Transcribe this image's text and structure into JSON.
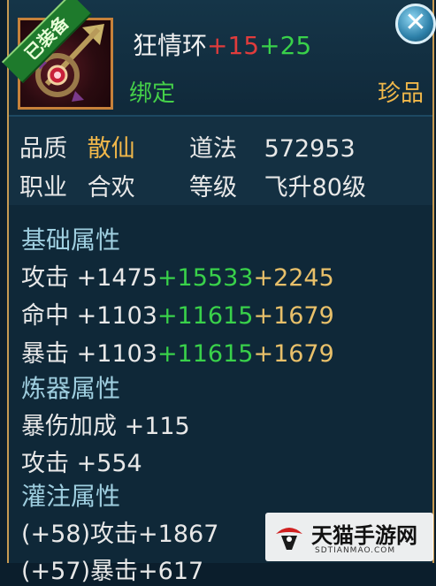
{
  "header": {
    "badge": "已装备",
    "item_name": "狂情环",
    "plus_red": "+15",
    "plus_green": "+25",
    "bind": "绑定",
    "rarity": "珍品",
    "close_icon": "close-icon"
  },
  "info": {
    "quality_label": "品质",
    "quality_value": "散仙",
    "dao_label": "道法",
    "dao_value": "572953",
    "job_label": "职业",
    "job_value": "合欢",
    "level_label": "等级",
    "level_value": "飞升80级"
  },
  "attributes": {
    "base_title": "基础属性",
    "base": [
      {
        "name": "攻击",
        "base": "+1475",
        "green": "+15533",
        "orange": "+2245"
      },
      {
        "name": "命中",
        "base": "+1103",
        "green": "+11615",
        "orange": "+1679"
      },
      {
        "name": "暴击",
        "base": "+1103",
        "green": "+11615",
        "orange": "+1679"
      }
    ],
    "refine_title": "炼器属性",
    "refine": [
      {
        "text": "暴伤加成 +115"
      },
      {
        "text": "攻击 +554"
      }
    ],
    "infuse_title": "灌注属性",
    "infuse": [
      {
        "text": "(+58)攻击+1867"
      },
      {
        "text": "(+57)暴击+617"
      }
    ]
  },
  "watermark": {
    "text": "天猫手游网",
    "sub": "SDTIANMAO.COM"
  },
  "colors": {
    "gold": "#f0b74a",
    "green": "#39d14a",
    "red": "#e03c3c",
    "border": "#c79a52"
  }
}
